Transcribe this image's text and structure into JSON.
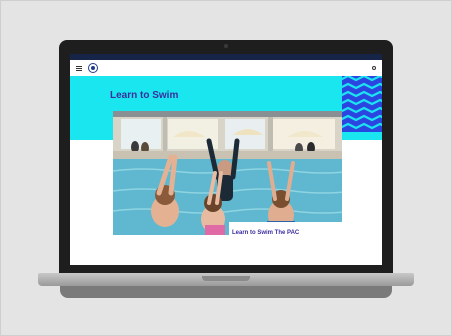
{
  "browser": {
    "top_links": [
      "",
      "",
      "",
      ""
    ],
    "top_right_links": [
      "",
      "",
      ""
    ]
  },
  "site": {
    "logo_text_line1": "",
    "logo_text_line2": "",
    "nav_items": [
      "",
      "",
      "",
      "",
      "",
      "",
      "",
      ""
    ]
  },
  "page": {
    "hero_title": "Learn to Swim",
    "card_caption": "Learn to Swim The PAC"
  },
  "colors": {
    "hero_bg": "#19e6ef",
    "title_purple": "#3b2e9e",
    "pattern_blue": "#2a45e0",
    "topbar_navy": "#162447"
  },
  "icons": [
    "menu-icon",
    "logo-icon",
    "search-icon"
  ]
}
